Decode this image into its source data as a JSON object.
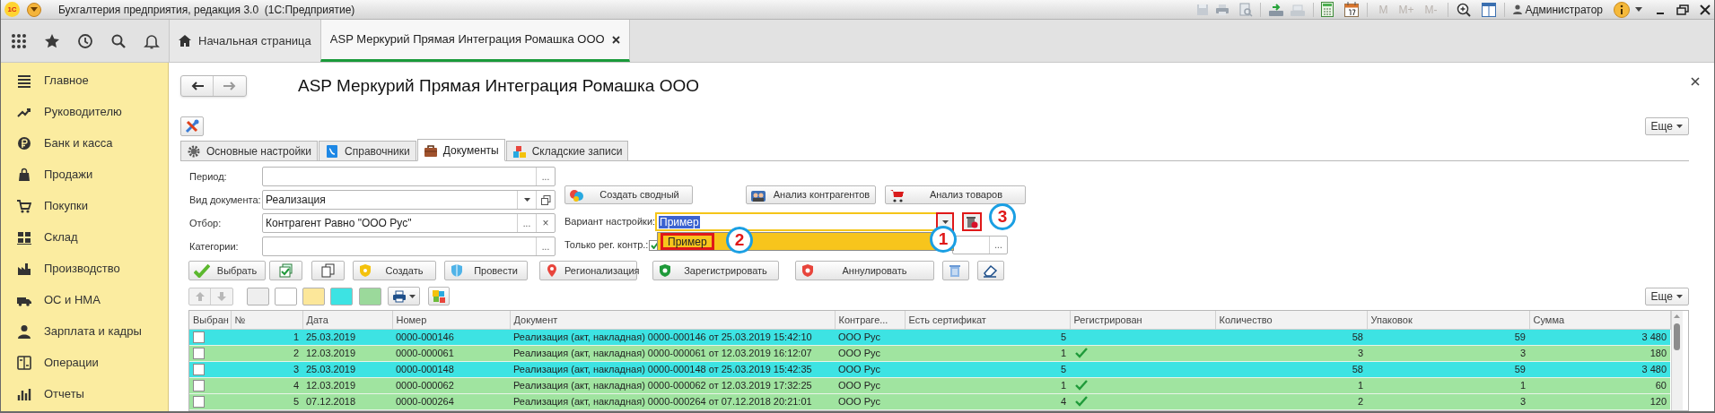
{
  "window": {
    "logo": "1С",
    "title": "Бухгалтерия предприятия, редакция 3.0  (1С:Предприятие)",
    "memory_buttons": [
      "M",
      "M+",
      "M-"
    ],
    "user": "Администратор"
  },
  "open_tabs": [
    {
      "label": "Начальная страница",
      "selected": false
    },
    {
      "label": "ASP Меркурий Прямая Интеграция Ромашка ООО",
      "selected": true
    }
  ],
  "sidebar": {
    "items": [
      {
        "label": "Главное"
      },
      {
        "label": "Руководителю"
      },
      {
        "label": "Банк и касса"
      },
      {
        "label": "Продажи"
      },
      {
        "label": "Покупки"
      },
      {
        "label": "Склад"
      },
      {
        "label": "Производство"
      },
      {
        "label": "ОС и НМА"
      },
      {
        "label": "Зарплата и кадры"
      },
      {
        "label": "Операции"
      },
      {
        "label": "Отчеты"
      }
    ]
  },
  "form": {
    "title": "ASP Меркурий Прямая Интеграция Ромашка ООО",
    "more_button": "Еще",
    "tabs": [
      {
        "label": "Основные настройки",
        "selected": false
      },
      {
        "label": "Справочники",
        "selected": false
      },
      {
        "label": "Документы",
        "selected": true
      },
      {
        "label": "Складские записи",
        "selected": false
      }
    ],
    "fields": [
      {
        "label": "Период:",
        "buttons": [
          {
            "kind": "choose",
            "label": "..."
          }
        ]
      },
      {
        "label": "Вид документа:",
        "value": "Реализация",
        "buttons": [
          {
            "kind": "dropdown"
          },
          {
            "kind": "open"
          }
        ]
      },
      {
        "label": "Отбор:",
        "value": "Контрагент Равно \"ООО Рус\"",
        "buttons": [
          {
            "kind": "choose",
            "label": "..."
          },
          {
            "kind": "clear",
            "label": "×"
          }
        ]
      },
      {
        "label": "Категории:",
        "buttons": [
          {
            "kind": "choose",
            "label": "..."
          }
        ]
      }
    ],
    "analysis_buttons": [
      {
        "label": "Создать сводный"
      },
      {
        "label": "Анализ контрагентов"
      },
      {
        "label": "Анализ товаров"
      }
    ],
    "setting_variant": {
      "label": "Вариант настройки:",
      "value": "Пример",
      "focused": true,
      "dropdown_items": [
        {
          "label": "Пример",
          "selected": true
        }
      ]
    },
    "only_registered": {
      "label": "Только рег. контр.:",
      "checked": true,
      "choose_button": "..."
    },
    "callouts": [
      "1",
      "2",
      "3"
    ],
    "commands": [
      {
        "kind": "text",
        "label": "Выбрать"
      },
      {
        "kind": "icon"
      },
      {
        "kind": "icon"
      },
      {
        "kind": "text",
        "label": "Создать"
      },
      {
        "kind": "text",
        "label": "Провести"
      },
      {
        "kind": "text",
        "label": "Регионализация"
      },
      {
        "kind": "text",
        "label": "Зарегистрировать"
      },
      {
        "kind": "text",
        "label": "Аннулировать"
      },
      {
        "kind": "icon"
      },
      {
        "kind": "icon"
      }
    ],
    "color_buttons": [
      {
        "color": "#eeeeee"
      },
      {
        "color": "#ffffff"
      },
      {
        "color": "#fce79a"
      },
      {
        "color": "#3de3e3"
      },
      {
        "color": "#9bd99b"
      }
    ],
    "list_more_button": "Еще",
    "table": {
      "columns": [
        "Выбран",
        "№",
        "Дата",
        "Номер",
        "Документ",
        "Контраге...",
        "Есть сертификат",
        "Регистрирован",
        "Количество",
        "Упаковок",
        "Сумма"
      ],
      "rows": [
        {
          "chosen": false,
          "number": "1",
          "date": "25.03.2019",
          "doc_number": "0000-000146",
          "document": "Реализация (акт, накладная) 0000-000146 от 25.03.2019 15:42:10",
          "counterparty": "ООО Рус",
          "certificate": "5",
          "registered": false,
          "quantity": "58",
          "packages": "59",
          "sum": "3 480",
          "color": "#3de3e3"
        },
        {
          "chosen": false,
          "number": "2",
          "date": "12.03.2019",
          "doc_number": "0000-000061",
          "document": "Реализация (акт, накладная) 0000-000061 от 12.03.2019 16:12:07",
          "counterparty": "ООО Рус",
          "certificate": "1",
          "registered": true,
          "quantity": "3",
          "packages": "3",
          "sum": "180",
          "color": "#a0e4a0"
        },
        {
          "chosen": false,
          "number": "3",
          "date": "25.03.2019",
          "doc_number": "0000-000148",
          "document": "Реализация (акт, накладная) 0000-000148 от 25.03.2019 15:42:35",
          "counterparty": "ООО Рус",
          "certificate": "5",
          "registered": false,
          "quantity": "58",
          "packages": "59",
          "sum": "3 480",
          "color": "#3de3e3"
        },
        {
          "chosen": false,
          "number": "4",
          "date": "12.03.2019",
          "doc_number": "0000-000062",
          "document": "Реализация (акт, накладная) 0000-000062 от 12.03.2019 17:32:25",
          "counterparty": "ООО Рус",
          "certificate": "1",
          "registered": true,
          "quantity": "1",
          "packages": "1",
          "sum": "60",
          "color": "#a0e4a0"
        },
        {
          "chosen": false,
          "number": "5",
          "date": "07.12.2018",
          "doc_number": "0000-000264",
          "document": "Реализация (акт, накладная) 0000-000264 от 07.12.2018 20:21:01",
          "counterparty": "ООО Рус",
          "certificate": "4",
          "registered": true,
          "quantity": "2",
          "packages": "3",
          "sum": "120",
          "color": "#a0e4a0"
        }
      ]
    }
  }
}
